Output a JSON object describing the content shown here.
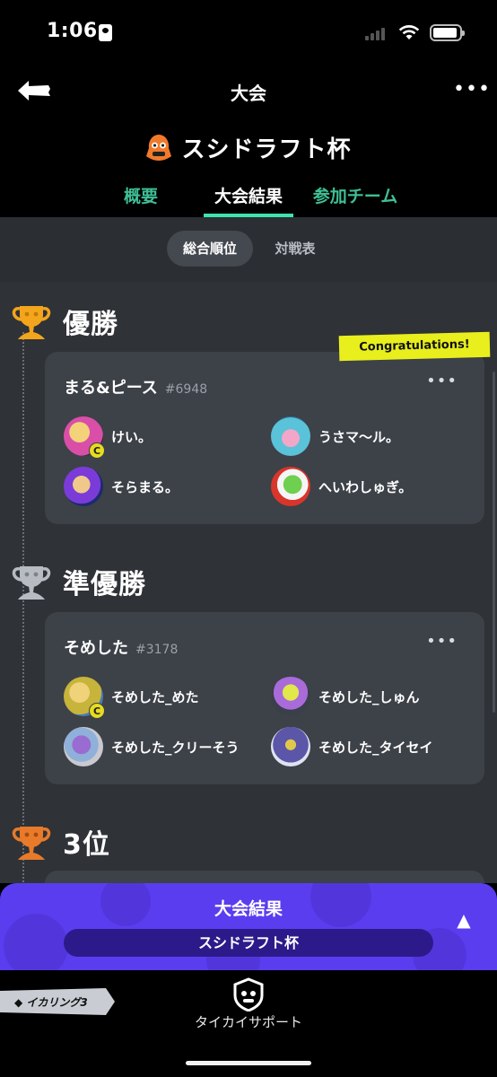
{
  "status_bar": {
    "time": "1:06"
  },
  "header": {
    "title": "大会",
    "tournament_name": "スシドラフト杯",
    "tabs": [
      {
        "label": "概要",
        "active": false
      },
      {
        "label": "大会結果",
        "active": true
      },
      {
        "label": "参加チーム",
        "active": false
      }
    ]
  },
  "subtabs": [
    {
      "label": "総合順位",
      "active": true
    },
    {
      "label": "対戦表",
      "active": false
    }
  ],
  "colors": {
    "accent_green": "#3fbf95",
    "gold": "#f3a51c",
    "silver": "#b7bcc3",
    "bronze": "#e87a2a",
    "results_bar": "#5b3df0",
    "congrats_yellow": "#e8ef1c"
  },
  "placements": [
    {
      "place_label": "優勝",
      "trophy": "gold-trophy-icon",
      "badge": "Congratulations!",
      "team": {
        "name": "まる&ピース",
        "tag": "#6948",
        "members": [
          {
            "name": "けい。",
            "badge": "C",
            "avatar_color": "#d94fa8"
          },
          {
            "name": "うさマ〜ル。",
            "badge": "",
            "avatar_color": "#5ac2d9"
          },
          {
            "name": "そらまる。",
            "badge": "",
            "avatar_color": "#3b59d9"
          },
          {
            "name": "へいわしゅぎ。",
            "badge": "",
            "avatar_color": "#d9352b"
          }
        ]
      }
    },
    {
      "place_label": "準優勝",
      "trophy": "silver-trophy-icon",
      "badge": "",
      "team": {
        "name": "そめした",
        "tag": "#3178",
        "members": [
          {
            "name": "そめした_めた",
            "badge": "C",
            "avatar_color": "#c7b43a"
          },
          {
            "name": "そめした_しゅん",
            "badge": "",
            "avatar_color": "#3a3f4a"
          },
          {
            "name": "そめした_クリーそう",
            "badge": "",
            "avatar_color": "#c9c9cf"
          },
          {
            "name": "そめした_タイセイ",
            "badge": "",
            "avatar_color": "#5b56a8"
          }
        ]
      }
    },
    {
      "place_label": "3位",
      "trophy": "bronze-trophy-icon",
      "badge": "",
      "team": null
    }
  ],
  "results_bar": {
    "title": "大会結果",
    "subtitle": "スシドラフト杯"
  },
  "bottom_nav": {
    "game_badge": "◆ イカリング3",
    "support_label": "タイカイサポート"
  }
}
